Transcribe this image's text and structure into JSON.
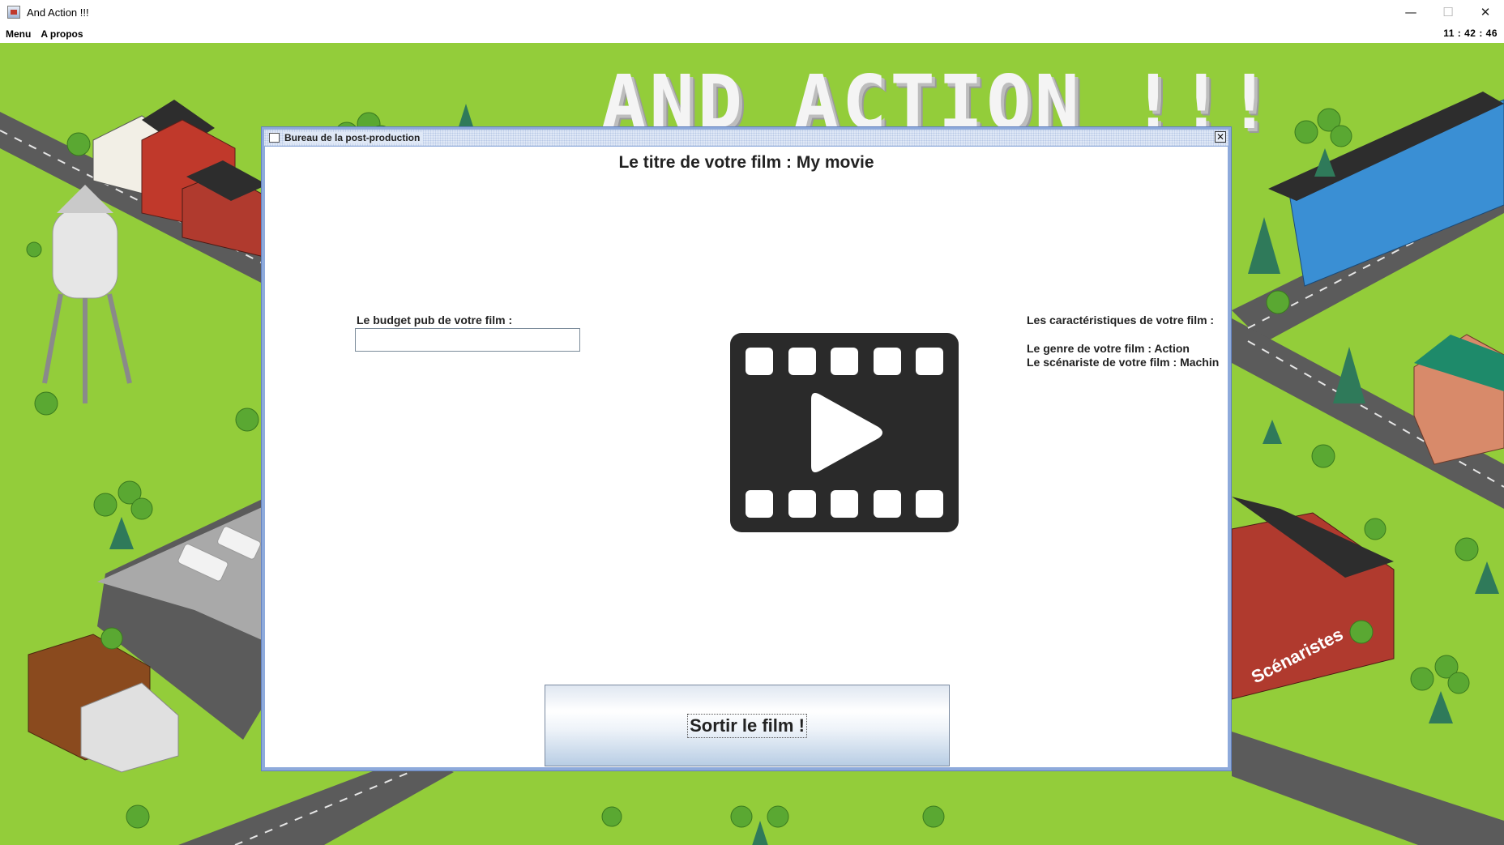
{
  "window": {
    "title": "And Action !!!",
    "controls": [
      "minimize",
      "maximize",
      "close"
    ]
  },
  "menubar": {
    "items": [
      {
        "label": "Menu"
      },
      {
        "label": "A propos"
      }
    ],
    "clock": "11 : 42 : 46"
  },
  "background": {
    "logo_text": "AND ACTION !!!",
    "building_label": "Scénaristes"
  },
  "post_production": {
    "frame_title": "Bureau de la post-production",
    "film_title": "Le titre de votre film : My movie",
    "budget_label": "Le budget pub de votre film :",
    "budget_value": "",
    "characteristics": {
      "heading": "Les caractéristiques de votre film :",
      "genre": "Le genre de votre film : Action",
      "writer": "Le scénariste de votre film : Machin"
    },
    "release_button": "Sortir le film !",
    "film_icon": "film-play-icon"
  },
  "colors": {
    "grass": "#93cd3a",
    "road": "#5b5b5b",
    "frame_border": "#8eaadb",
    "film_icon": "#2a2a2a"
  }
}
